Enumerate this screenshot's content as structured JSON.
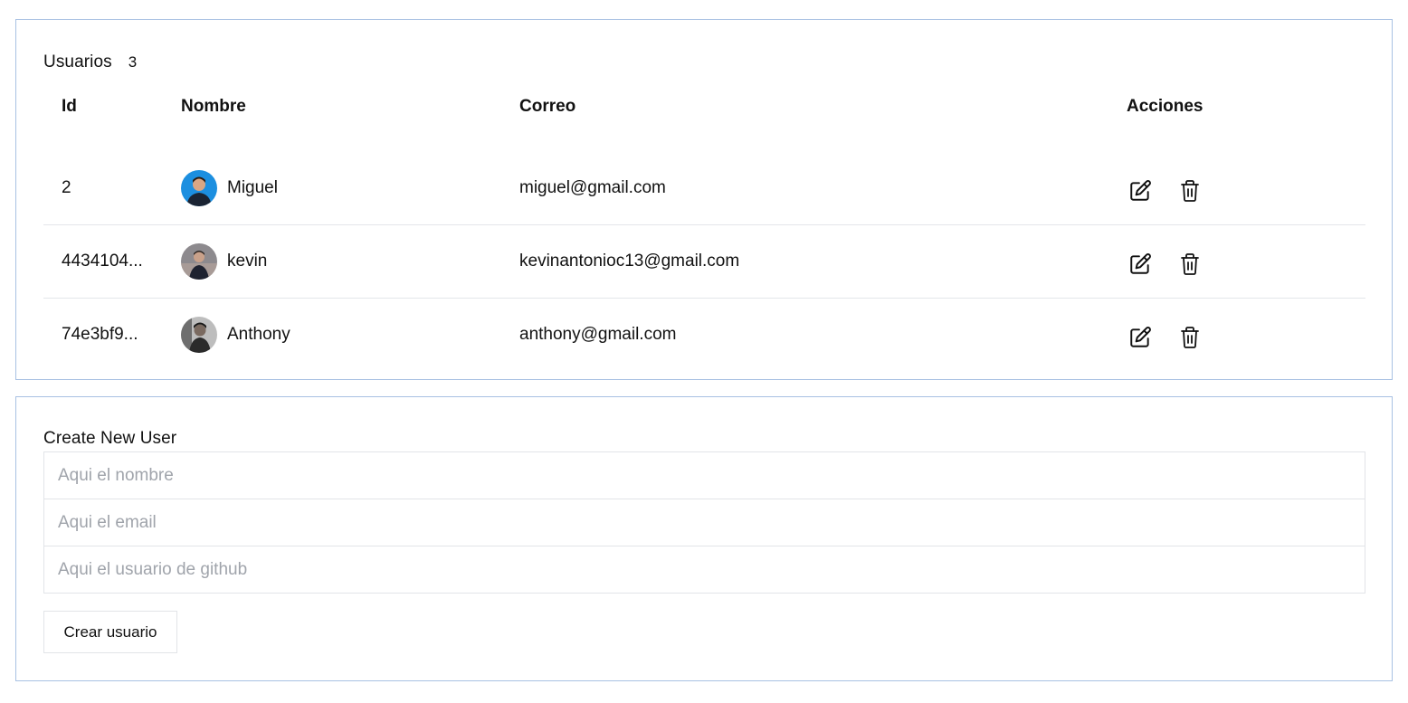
{
  "users_panel": {
    "title": "Usuarios",
    "count": "3",
    "columns": {
      "id": "Id",
      "name": "Nombre",
      "email": "Correo",
      "actions": "Acciones"
    },
    "rows": [
      {
        "id": "2",
        "name": "Miguel",
        "email": "miguel@gmail.com",
        "avatar": "avatar-icon"
      },
      {
        "id": "4434104...",
        "name": "kevin",
        "email": "kevinantonioc13@gmail.com",
        "avatar": "avatar-icon"
      },
      {
        "id": "74e3bf9...",
        "name": "Anthony",
        "email": "anthony@gmail.com",
        "avatar": "avatar-icon"
      }
    ],
    "row_actions": [
      "edit-icon",
      "trash-icon"
    ]
  },
  "create_panel": {
    "title": "Create New User",
    "name_placeholder": "Aqui el nombre",
    "email_placeholder": "Aqui el email",
    "github_placeholder": "Aqui el usuario de github",
    "submit_label": "Crear usuario"
  },
  "colors": {
    "card_border": "#a8c1e3",
    "row_divider": "#e4e6ea",
    "input_border": "#e2e4e8",
    "placeholder": "#a0a4ab"
  }
}
